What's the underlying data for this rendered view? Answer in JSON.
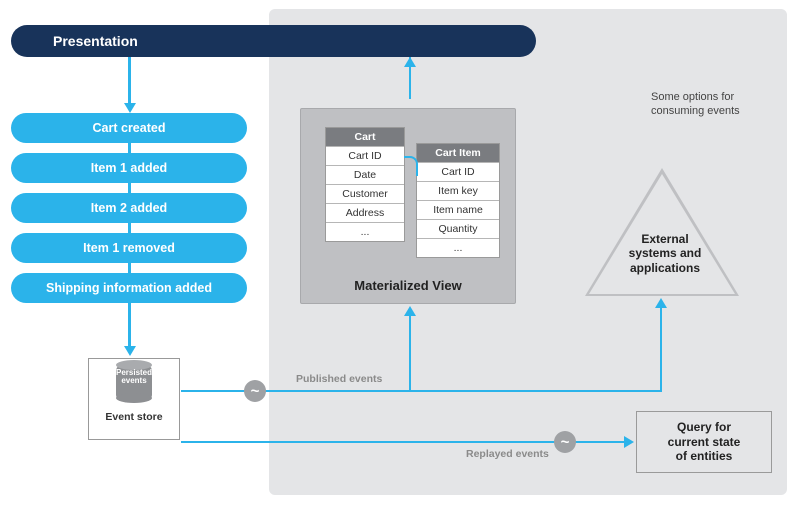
{
  "presentation": {
    "label": "Presentation"
  },
  "events": [
    {
      "label": "Cart created"
    },
    {
      "label": "Item 1 added"
    },
    {
      "label": "Item 2 added"
    },
    {
      "label": "Item 1 removed"
    },
    {
      "label": "Shipping information added"
    }
  ],
  "panel": {
    "note_line1": "Some options for",
    "note_line2": "consuming events"
  },
  "store": {
    "cyl_line1": "Persisted",
    "cyl_line2": "events",
    "caption": "Event store"
  },
  "mview": {
    "title": "Materialized View",
    "table1": {
      "header": "Cart",
      "rows": [
        "Cart ID",
        "Date",
        "Customer",
        "Address",
        "..."
      ]
    },
    "table2": {
      "header": "Cart Item",
      "rows": [
        "Cart ID",
        "Item key",
        "Item name",
        "Quantity",
        "..."
      ]
    }
  },
  "triangle": {
    "line1": "External",
    "line2": "systems and",
    "line3": "applications"
  },
  "query": {
    "line1": "Query for",
    "line2": "current state",
    "line3": "of entities"
  },
  "flows": {
    "published": "Published events",
    "replayed": "Replayed events"
  }
}
